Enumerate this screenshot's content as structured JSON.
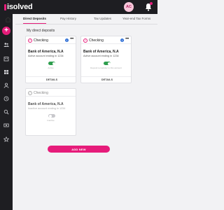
{
  "app": {
    "brand": "isolved",
    "avatar_initials": "AC"
  },
  "colors": {
    "accent": "#e61c7a",
    "nav_bg": "#1e1e22",
    "toggle_on": "#2e9e4e",
    "info": "#2f6fd6"
  },
  "icons": {
    "topbar": [
      "bell-icon"
    ],
    "sidebar": [
      "plus-icon",
      "people-icon",
      "building-icon",
      "grid-icon",
      "person-icon",
      "clock-icon",
      "search-icon",
      "money-icon",
      "star-icon"
    ]
  },
  "tabs": [
    "Direct Deposits",
    "Pay History",
    "Tax Updates",
    "Year-end Tax Forms"
  ],
  "page_title": "My direct deposits",
  "cards": [
    {
      "account_type": "Checking",
      "bank": "Bank of America, N.A",
      "account_line": "Active account ending in 1234",
      "toggle_caption": "Active",
      "details_label": "DETAILS"
    },
    {
      "account_type": "Checking",
      "bank": "Bank of America, N.A",
      "account_line": "Active account ending in 1234",
      "toggle_caption": "Deposit remainder to this account",
      "details_label": "DETAILS"
    },
    {
      "account_type": "Checking",
      "bank": "Bank of America, N.A",
      "account_line": "Inactive account ending in 1234",
      "toggle_caption": "Inactive"
    }
  ],
  "add_button": "ADD NEW"
}
